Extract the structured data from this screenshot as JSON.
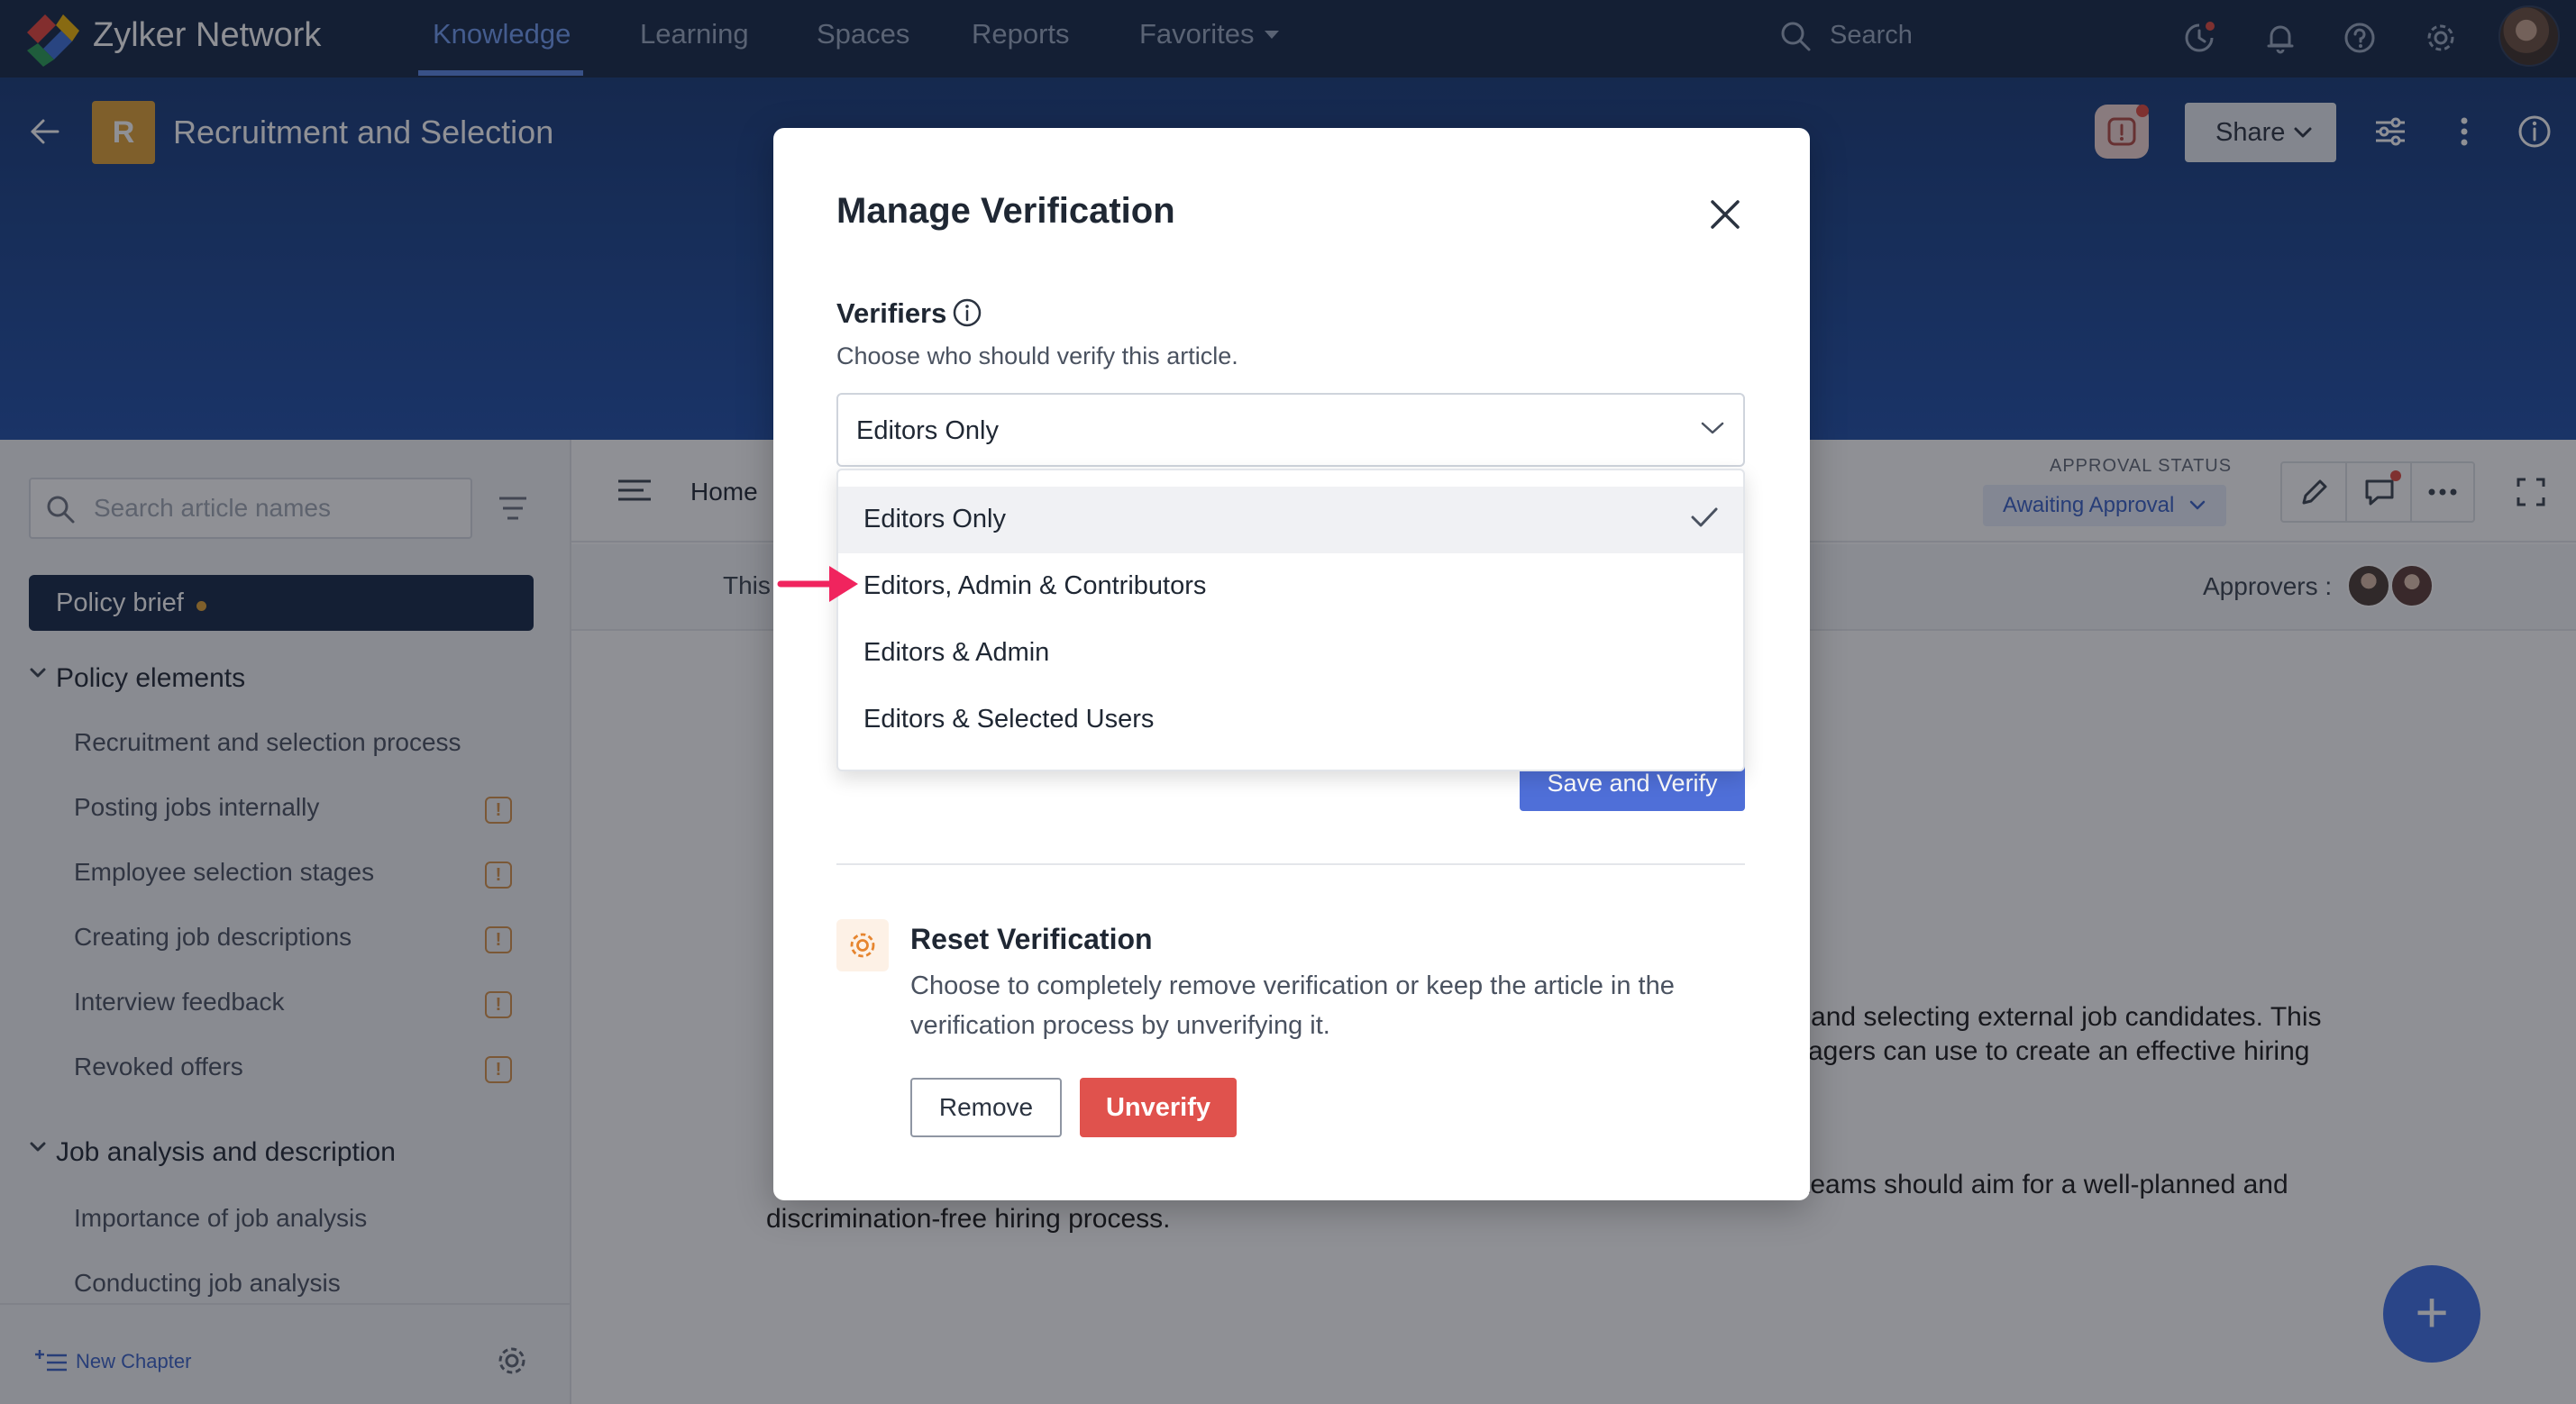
{
  "app": {
    "brand": "Zylker Network",
    "nav": [
      {
        "label": "Knowledge",
        "active": true
      },
      {
        "label": "Learning",
        "active": false
      },
      {
        "label": "Spaces",
        "active": false
      },
      {
        "label": "Reports",
        "active": false
      },
      {
        "label": "Favorites",
        "active": false
      }
    ],
    "search_label": "Search"
  },
  "header": {
    "space_initial": "R",
    "title": "Recruitment and Selection",
    "share_label": "Share"
  },
  "sidebar": {
    "search_placeholder": "Search article names",
    "active_item": "Policy brief",
    "chapters": [
      {
        "title": "Policy elements",
        "items": [
          {
            "label": "Recruitment and selection process",
            "warning": false
          },
          {
            "label": "Posting jobs internally",
            "warning": true
          },
          {
            "label": "Employee selection stages",
            "warning": true
          },
          {
            "label": "Creating job descriptions",
            "warning": true
          },
          {
            "label": "Interview feedback",
            "warning": true
          },
          {
            "label": "Revoked offers",
            "warning": true
          }
        ]
      },
      {
        "title": "Job analysis and description",
        "items": [
          {
            "label": "Importance of job analysis",
            "warning": false
          },
          {
            "label": "Conducting job analysis",
            "warning": false
          }
        ]
      }
    ],
    "warning_glyph": "!",
    "new_chapter_label": "New Chapter"
  },
  "content": {
    "breadcrumb_home": "Home",
    "approval_status_label": "APPROVAL STATUS",
    "approval_status_value": "Awaiting Approval",
    "subbar_text": "This",
    "approvers_label": "Approvers :",
    "body_lines": [
      "g and selecting external job candidates. This",
      "agers can use to create an effective hiring",
      "teams should aim for a well-planned and",
      "discrimination-free hiring process."
    ],
    "fab_label": "+"
  },
  "modal": {
    "title": "Manage Verification",
    "verifiers_title": "Verifiers",
    "verifiers_help": "Choose who should verify this article.",
    "selected_value": "Editors Only",
    "options": [
      {
        "label": "Editors Only",
        "selected": true
      },
      {
        "label": "Editors, Admin & Contributors",
        "selected": false
      },
      {
        "label": "Editors & Admin",
        "selected": false
      },
      {
        "label": "Editors & Selected Users",
        "selected": false
      }
    ],
    "save_verify_label": "Save and Verify",
    "reset_title": "Reset Verification",
    "reset_description": "Choose to completely remove verification or keep the article in the verification process by unverifying it.",
    "remove_label": "Remove",
    "unverify_label": "Unverify"
  },
  "colors": {
    "nav_bg": "#142846",
    "hero_bg": "#1f4fa8",
    "accent": "#4f6fd8",
    "danger": "#e0524d",
    "annotation_arrow": "#f0245e"
  }
}
